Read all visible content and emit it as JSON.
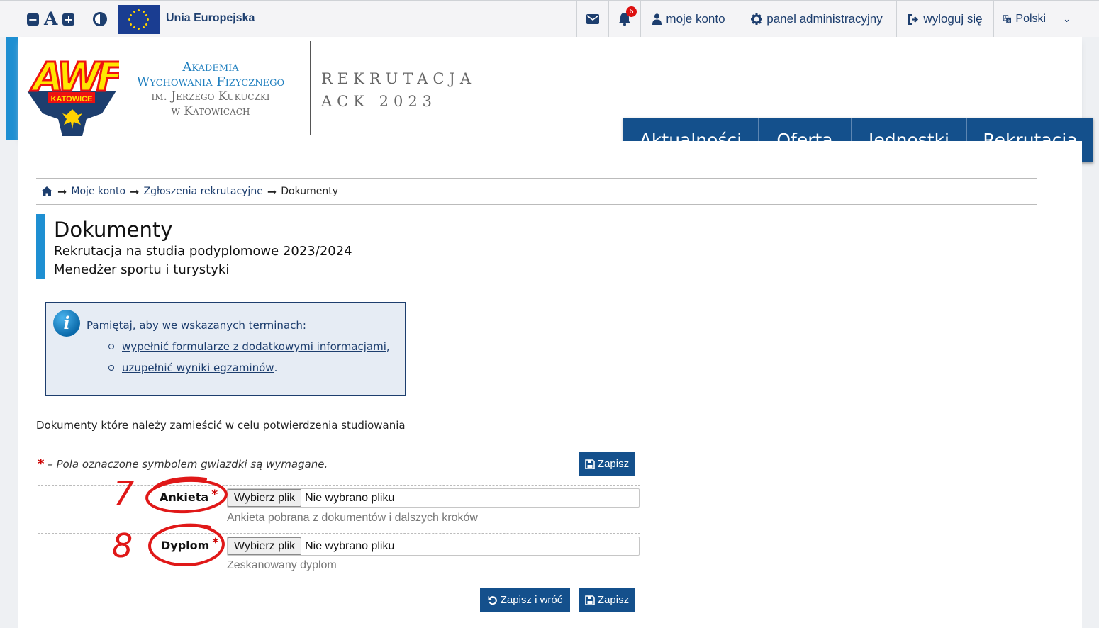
{
  "topbar": {
    "eu_label": "Unia Europejska",
    "notifications_count": "6",
    "account": "moje konto",
    "admin_panel": "panel administracyjny",
    "logout": "wyloguj się",
    "language": "Polski",
    "icons": {
      "decrease": "minus-icon",
      "font": "font-size-icon",
      "increase": "plus-icon",
      "contrast": "contrast-icon",
      "mail": "envelope-icon",
      "bell": "bell-icon",
      "user": "user-icon",
      "gear": "gear-icon",
      "logout": "sign-out-icon",
      "language": "translate-icon",
      "dropdown": "chevron-down-icon"
    }
  },
  "header": {
    "logo_text": "AWF",
    "logo_sub": "KATOWICE",
    "uni_line1": "Akademia",
    "uni_line2": "Wychowania Fizycznego",
    "uni_line3": "im. Jerzego Kukuczki",
    "uni_line4": "w Katowicach",
    "rek_line1": "REKRUTACJA",
    "rek_line2": "ACK 2023"
  },
  "mainnav": {
    "items": [
      "Aktualności",
      "Oferta",
      "Jednostki",
      "Rekrutacja"
    ]
  },
  "breadcrumb": {
    "home_icon": "home-icon",
    "items": [
      "Moje konto",
      "Zgłoszenia rekrutacyjne",
      "Dokumenty"
    ]
  },
  "page": {
    "title": "Dokumenty",
    "subtitle1": "Rekrutacja na studia podyplomowe 2023/2024",
    "subtitle2": "Menedżer sportu i turystyki"
  },
  "info": {
    "icon": "info-icon",
    "text": "Pamiętaj, aby we wskazanych terminach:",
    "items": [
      {
        "link": "wypełnić formularze z dodatkowymi informacjami",
        "suffix": ","
      },
      {
        "link": "uzupełnić wyniki egzaminów",
        "suffix": "."
      }
    ]
  },
  "form": {
    "description": "Dokumenty które należy zamieścić w celu potwierdzenia studiowania",
    "required_star": "*",
    "required_note": "– Pola oznaczone symbolem gwiazdki są wymagane.",
    "save": "Zapisz",
    "save_and_back": "Zapisz i wróć",
    "fields": [
      {
        "label": "Ankieta",
        "button": "Wybierz plik",
        "filename": "Nie wybrano pliku",
        "help": "Ankieta pobrana z dokumentów i dalszych kroków"
      },
      {
        "label": "Dyplom",
        "button": "Wybierz plik",
        "filename": "Nie wybrano pliku",
        "help": "Zeskanowany dyplom"
      }
    ]
  },
  "annotations": {
    "num1": "7",
    "num2": "8",
    "color": "#e01818"
  },
  "colors": {
    "primary": "#14508c",
    "accent": "#1e8fd2",
    "required": "#cc0000"
  }
}
